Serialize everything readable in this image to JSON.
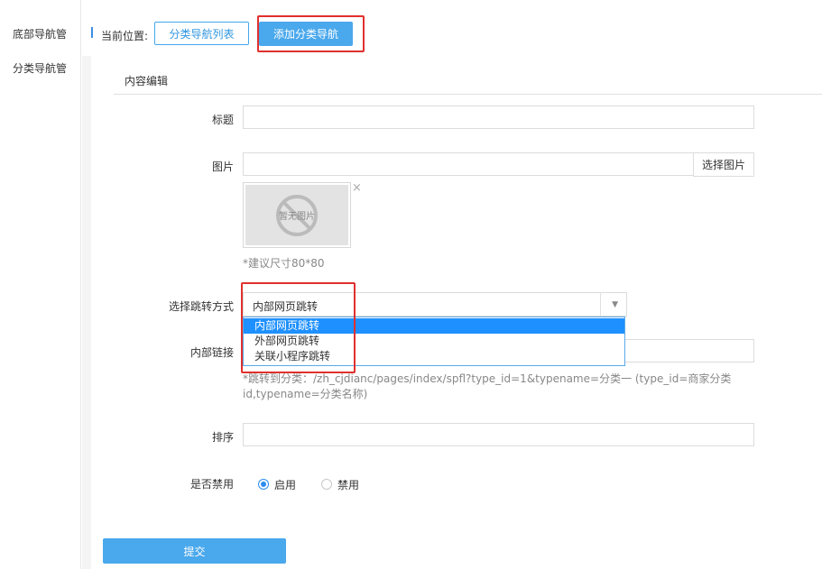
{
  "sidebar": {
    "items": [
      {
        "label": "底部导航管"
      },
      {
        "label": "分类导航管"
      }
    ]
  },
  "breadcrumb": {
    "label": "当前位置:",
    "list_button": "分类导航列表",
    "add_button": "添加分类导航"
  },
  "form": {
    "section_title": "内容编辑",
    "title_label": "标题",
    "title_value": "",
    "image_label": "图片",
    "image_value": "",
    "select_image_button": "选择图片",
    "thumb_placeholder": "暂无图片",
    "thumb_remove": "×",
    "image_hint": "*建议尺寸80*80",
    "jump_label": "选择跳转方式",
    "jump_selected": "内部网页跳转",
    "jump_options": [
      "内部网页跳转",
      "外部网页跳转",
      "关联小程序跳转"
    ],
    "link_label": "内部链接",
    "link_value": "",
    "link_hint_1": "*跳转到分类：/zh_cjdianc/pages/index/spfl?type_id=1&typename=分类一   (type_id=商家分类",
    "link_hint_2": "id,typename=分类名称)",
    "sort_label": "排序",
    "sort_value": "",
    "disable_label": "是否禁用",
    "radio_enable": "启用",
    "radio_disable": "禁用",
    "submit_button": "提交"
  }
}
